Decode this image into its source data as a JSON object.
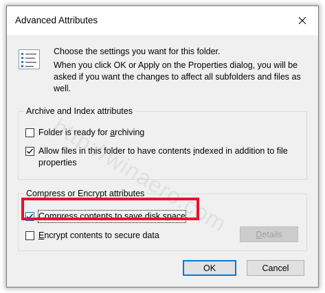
{
  "dialog": {
    "title": "Advanced Attributes",
    "close_label": "Close"
  },
  "info": {
    "line1": "Choose the settings you want for this folder.",
    "line2": "When you click OK or Apply on the Properties dialog, you will be asked if you want the changes to affect all subfolders and files as well."
  },
  "archive_group": {
    "label": "Archive and Index attributes",
    "ready_for_archiving": {
      "before": "Folder is ready for ",
      "key": "a",
      "after": "rchiving",
      "checked": false
    },
    "allow_indexing": {
      "before": "Allow files in this folder to have contents ",
      "key": "i",
      "after": "ndexed in addition to file properties",
      "checked": true
    }
  },
  "compress_group": {
    "label": "Compress or Encrypt attributes",
    "compress": {
      "before": "",
      "key": "C",
      "after": "ompress contents to save disk space",
      "checked": true
    },
    "encrypt": {
      "before": "",
      "key": "E",
      "after": "ncrypt contents to secure data",
      "checked": false
    },
    "details_button": {
      "key": "D",
      "after": "etails",
      "enabled": false
    }
  },
  "buttons": {
    "ok": "OK",
    "cancel": "Cancel"
  },
  "watermark": "http://winaero.com",
  "colors": {
    "accent": "#0078d7",
    "highlight": "#e8112d"
  }
}
